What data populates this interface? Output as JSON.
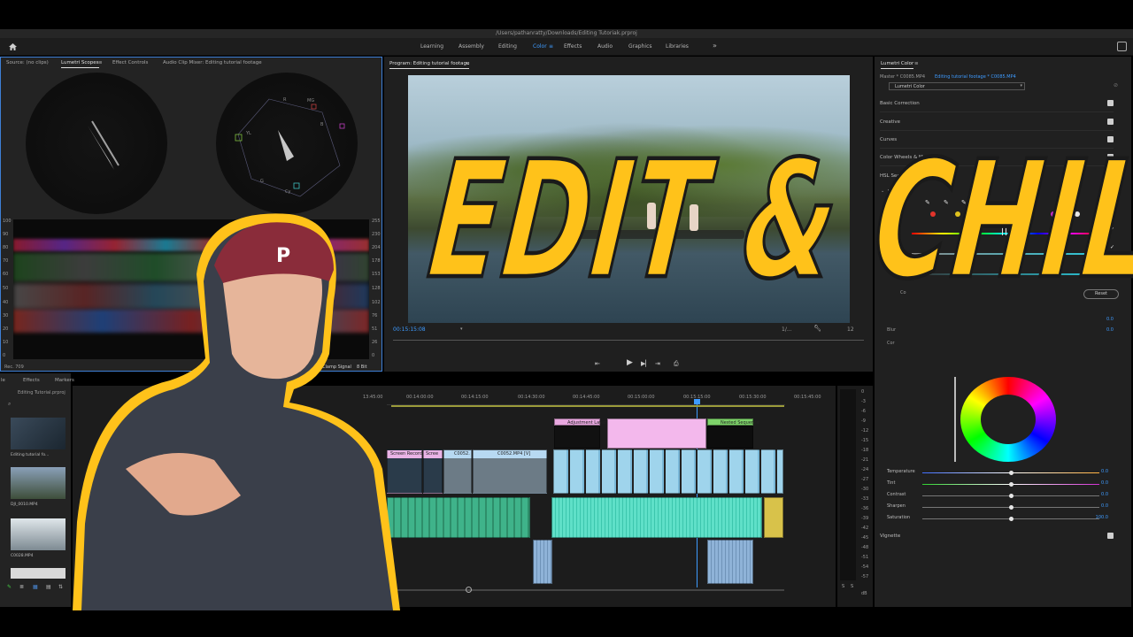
{
  "window": {
    "title": "/Users/pathanratty/Downloads/Editing Tutoriak.prproj"
  },
  "workspaces": [
    {
      "label": "Learning",
      "active": false
    },
    {
      "label": "Assembly",
      "active": false
    },
    {
      "label": "Editing",
      "active": false
    },
    {
      "label": "Color",
      "active": true
    },
    {
      "label": "Effects",
      "active": false
    },
    {
      "label": "Audio",
      "active": false
    },
    {
      "label": "Graphics",
      "active": false
    },
    {
      "label": "Libraries",
      "active": false
    }
  ],
  "source_panel": {
    "tabs": [
      "Source: (no clips)",
      "Lumetri Scopes",
      "Effect Controls",
      "Audio Clip Mixer: Editing tutorial footage"
    ],
    "active_tab": "Lumetri Scopes",
    "left_scale": [
      "100",
      "90",
      "80",
      "70",
      "60",
      "50",
      "40",
      "30",
      "20",
      "10",
      "0"
    ],
    "right_scale": [
      "255",
      "230",
      "204",
      "178",
      "153",
      "128",
      "102",
      "76",
      "51",
      "26",
      "0"
    ],
    "rec_label": "Rec. 709",
    "clamp_label": "Clamp Signal",
    "bit_label": "8 Bit",
    "vectorscope_labels": [
      "R",
      "MG",
      "B",
      "YL",
      "G",
      "Cy"
    ]
  },
  "project_panel": {
    "tabs": [
      "le",
      "Effects",
      "Markers",
      "History"
    ],
    "project_name": "Editing Tutorial.prproj",
    "items": [
      {
        "name": "Editing tutorial fo...",
        "duration": "51:05:21"
      },
      {
        "name": "DJI_0010.MP4",
        "duration": "8:58:20"
      },
      {
        "name": "C0028.MP4",
        "duration": "30:04"
      }
    ]
  },
  "program_panel": {
    "title": "Program: Editing tutorial footage",
    "timecode_left": "00:15:15:08",
    "timecode_right": "1/...",
    "timecode_frag": "12"
  },
  "timeline": {
    "ruler": [
      "13:45:00",
      "00:14:00:00",
      "00:14:15:00",
      "00:14:30:00",
      "00:14:45:00",
      "00:15:00:00",
      "00:15:15:00",
      "00:15:30:00",
      "00:15:45:00"
    ],
    "clips": {
      "adjustment": "Adjustment Layer",
      "nested": "Nested Sequence",
      "screen_rec": "Screen Recordin",
      "scree": "Scree",
      "c0052": "C0052.",
      "c0052_mp4": "C0052.MP4 [V]"
    },
    "meter_scale": [
      "0",
      "-3",
      "-6",
      "-9",
      "-12",
      "-15",
      "-18",
      "-21",
      "-24",
      "-27",
      "-30",
      "-33",
      "-36",
      "-39",
      "-42",
      "-45",
      "-48",
      "-51",
      "-54",
      "-57",
      "dB"
    ],
    "meter_solo": [
      "S",
      "S"
    ]
  },
  "lumetri": {
    "panel_title": "Lumetri Color",
    "master_clip": "Master * C0085.MP4",
    "sequence_clip": "Editing tutorial footage * C0085.MP4",
    "effect_select": "Lumetri Color",
    "sections": [
      "Basic Correction",
      "Creative",
      "Curves",
      "Color Wheels & Match",
      "HSL Secondary"
    ],
    "key_label": "Key",
    "set_color_label": "Set color",
    "hsl_letters": [
      "H",
      "S",
      "L"
    ],
    "color_swatches": [
      "#e2342b",
      "#e0c21e",
      "#2fbf3a",
      "#22c1c9",
      "#2d5fe0",
      "#c42fc4",
      "#e6e6e6"
    ],
    "reset_label": "Reset",
    "refine_labels": [
      "Co",
      "Blur",
      "Cor"
    ],
    "refine_values": [
      "0.0",
      "0.0"
    ],
    "sliders": [
      {
        "label": "Temperature",
        "value": "0.0",
        "pos": 0.5,
        "track": "linear-gradient(90deg,#3e6cff,#fff 50%,#ffb03e)"
      },
      {
        "label": "Tint",
        "value": "0.0",
        "pos": 0.5,
        "track": "linear-gradient(90deg,#2fd12f,#fff 50%,#d12fd1)"
      },
      {
        "label": "Contrast",
        "value": "0.0",
        "pos": 0.5,
        "track": "#777"
      },
      {
        "label": "Sharpen",
        "value": "0.0",
        "pos": 0.5,
        "track": "#777"
      },
      {
        "label": "Saturation",
        "value": "100.0",
        "pos": 0.5,
        "track": "#777"
      }
    ],
    "vignette_label": "Vignette"
  },
  "overlay": {
    "title_text": "EDIT & CHILL",
    "title_color": "#ffc21a"
  }
}
